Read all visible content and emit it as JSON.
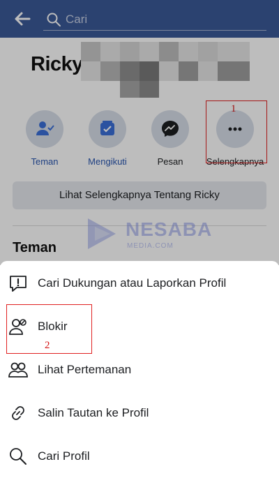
{
  "header": {
    "search_placeholder": "Cari",
    "color": "#3b5998"
  },
  "profile": {
    "name_visible": "Ricky f",
    "name_note_redacted": true
  },
  "actions": [
    {
      "label": "Teman",
      "icon": "friends-icon"
    },
    {
      "label": "Mengikuti",
      "icon": "following-icon"
    },
    {
      "label": "Pesan",
      "icon": "messenger-icon"
    },
    {
      "label": "Selengkapnya",
      "icon": "more-icon"
    }
  ],
  "about_button": "Lihat Selengkapnya Tentang Ricky",
  "friends_section_title": "Teman",
  "watermark": {
    "title": "NESABA",
    "sub": "MEDIA.COM"
  },
  "annotations": {
    "marker1": "1",
    "marker2": "2"
  },
  "sheet": {
    "items": [
      {
        "label": "Cari Dukungan atau Laporkan Profil",
        "icon": "report-icon"
      },
      {
        "label": "Blokir",
        "icon": "block-user-icon"
      },
      {
        "label": "Lihat Pertemanan",
        "icon": "friendship-icon"
      },
      {
        "label": "Salin Tautan ke Profil",
        "icon": "link-icon"
      },
      {
        "label": "Cari Profil",
        "icon": "search-icon"
      }
    ]
  }
}
